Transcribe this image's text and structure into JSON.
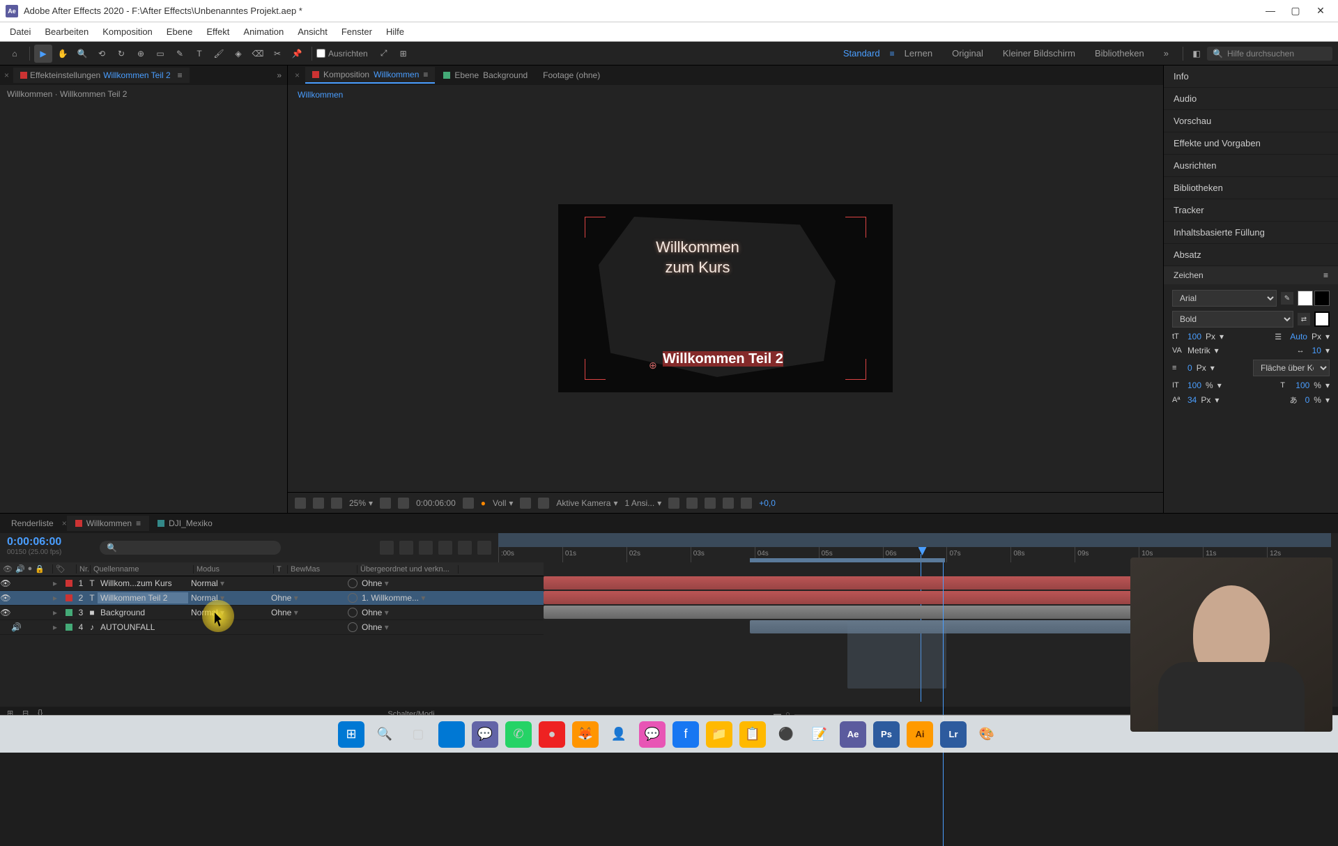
{
  "titlebar": {
    "app_icon_text": "Ae",
    "title": "Adobe After Effects 2020 - F:\\After Effects\\Unbenanntes Projekt.aep *"
  },
  "menubar": [
    "Datei",
    "Bearbeiten",
    "Komposition",
    "Ebene",
    "Effekt",
    "Animation",
    "Ansicht",
    "Fenster",
    "Hilfe"
  ],
  "toolbar": {
    "align_label": "Ausrichten",
    "workspace_active": "Standard",
    "workspaces": [
      "Lernen",
      "Original",
      "Kleiner Bildschirm",
      "Bibliotheken"
    ],
    "search_placeholder": "Hilfe durchsuchen"
  },
  "left_panel": {
    "tab1": "Effekteinstellungen",
    "tab1_link": "Willkommen Teil 2",
    "subtitle": "Willkommen · Willkommen Teil 2"
  },
  "center": {
    "tab_comp_prefix": "Komposition",
    "tab_comp_name": "Willkommen",
    "tab_layer_prefix": "Ebene",
    "tab_layer_name": "Background",
    "tab_footage": "Footage (ohne)",
    "breadcrumb": "Willkommen",
    "canvas_text1_line1": "Willkommen",
    "canvas_text1_line2": "zum Kurs",
    "canvas_text2": "Willkommen Teil 2",
    "footer": {
      "zoom": "25%",
      "time": "0:00:06:00",
      "res": "Voll",
      "camera": "Aktive Kamera",
      "views": "1 Ansi...",
      "exposure": "+0,0"
    }
  },
  "right_panel": {
    "items": [
      "Info",
      "Audio",
      "Vorschau",
      "Effekte und Vorgaben",
      "Ausrichten",
      "Bibliotheken",
      "Tracker",
      "Inhaltsbasierte Füllung",
      "Absatz"
    ],
    "char_title": "Zeichen",
    "font": "Arial",
    "style": "Bold",
    "size": "100",
    "size_unit": "Px",
    "leading_auto": "Auto",
    "leading_unit": "Px",
    "kerning": "Metrik",
    "tracking": "10",
    "stroke": "0",
    "stroke_unit": "Px",
    "stroke_mode": "Fläche über Kon...",
    "scale_v": "100",
    "scale_h": "100",
    "percent": "%",
    "baseline": "34",
    "baseline_unit": "Px",
    "tsume": "0"
  },
  "timeline": {
    "tabs": {
      "render": "Renderliste",
      "comp": "Willkommen",
      "comp2": "DJI_Mexiko"
    },
    "time": "0:00:06:00",
    "frames": "00150 (25.00 fps)",
    "columns": {
      "nr": "Nr.",
      "name": "Quellenname",
      "mode": "Modus",
      "t": "T",
      "trkmat": "BewMas",
      "parent": "Übergeordnet und verkn..."
    },
    "layers": [
      {
        "num": "1",
        "color": "#c33",
        "icon": "T",
        "name": "Willkom...zum Kurs",
        "mode": "Normal",
        "trkmat": "",
        "parent": "Ohne"
      },
      {
        "num": "2",
        "color": "#c33",
        "icon": "T",
        "name": "Willkommen Teil 2",
        "mode": "Normal",
        "trkmat": "Ohne",
        "parent": "1. Willkomme..."
      },
      {
        "num": "3",
        "color": "#4a7",
        "icon": "■",
        "name": "Background",
        "mode": "Normal",
        "trkmat": "Ohne",
        "parent": "Ohne"
      },
      {
        "num": "4",
        "color": "#4a7",
        "icon": "♪",
        "name": "AUTOUNFALL",
        "mode": "",
        "trkmat": "",
        "parent": "Ohne"
      }
    ],
    "ruler": [
      ":00s",
      "01s",
      "02s",
      "03s",
      "04s",
      "05s",
      "06s",
      "07s",
      "08s",
      "09s",
      "10s",
      "11s",
      "12s"
    ],
    "footer_text": "Schalter/Modi"
  }
}
